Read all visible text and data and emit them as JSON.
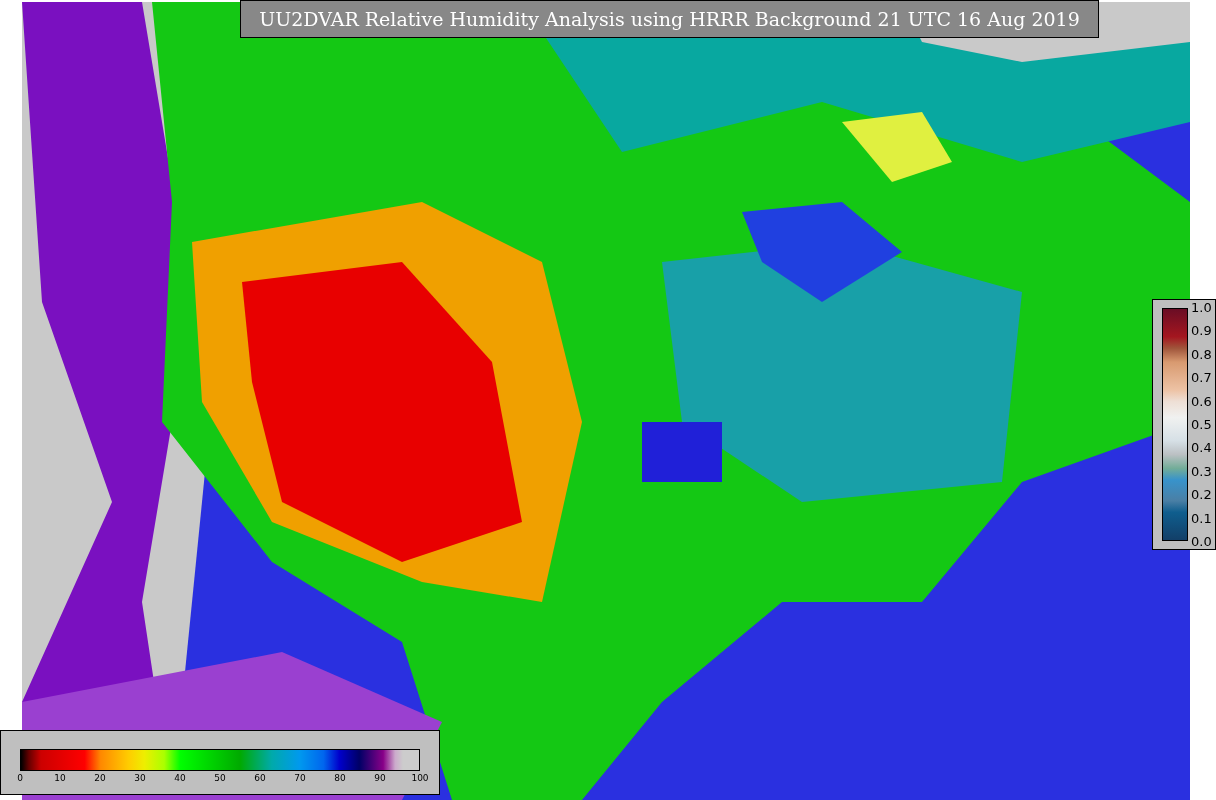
{
  "title": "UU2DVAR Relative Humidity Analysis using HRRR Background 21 UTC 16 Aug 2019",
  "humidity_colorbar": {
    "ticks": [
      "0",
      "10",
      "20",
      "30",
      "40",
      "50",
      "60",
      "70",
      "80",
      "90",
      "100"
    ]
  },
  "observation_colorbar": {
    "ticks": [
      "1.0",
      "0.9",
      "0.8",
      "0.7",
      "0.6",
      "0.5",
      "0.4",
      "0.3",
      "0.2",
      "0.1",
      "0.0"
    ]
  }
}
